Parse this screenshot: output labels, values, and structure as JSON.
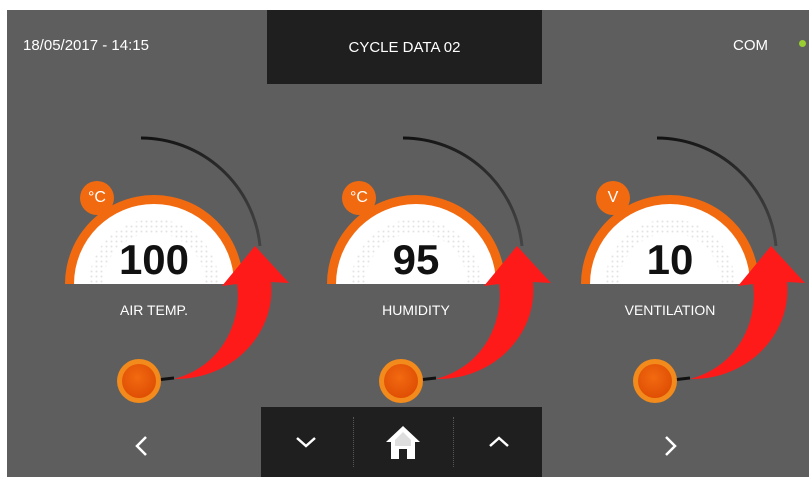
{
  "header": {
    "datetime": "18/05/2017 - 14:15",
    "title": "CYCLE DATA 02",
    "com_label": "COM"
  },
  "gauges": [
    {
      "unit": "°C",
      "value": "100",
      "label": "AIR TEMP."
    },
    {
      "unit": "°C",
      "value": "95",
      "label": "HUMIDITY"
    },
    {
      "unit": "V",
      "value": "10",
      "label": "VENTILATION"
    }
  ],
  "nav": {
    "prev_icon": "chevron-left-icon",
    "down_icon": "chevron-down-icon",
    "home_icon": "home-icon",
    "up_icon": "chevron-up-icon",
    "next_icon": "chevron-right-icon"
  },
  "colors": {
    "background": "#5e5e5e",
    "panel": "#1f1f1f",
    "accent_orange": "#f26a0f",
    "arrow_red": "#ff1a1a",
    "com_indicator": "#9acd32",
    "text": "#ffffff"
  }
}
